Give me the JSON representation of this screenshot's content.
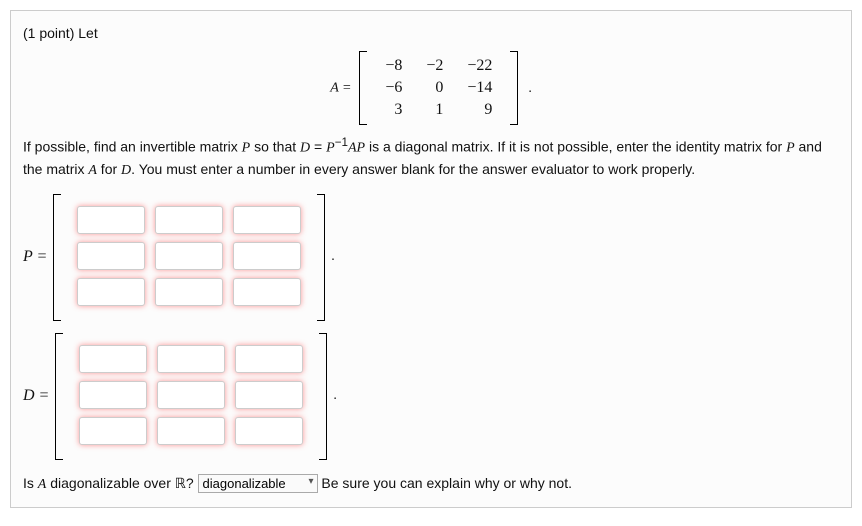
{
  "problem": {
    "points_label": "(1 point) Let",
    "A_matrix": {
      "prefix": "A =",
      "rows": [
        [
          "−8",
          "−2",
          "−22"
        ],
        [
          "−6",
          "0",
          "−14"
        ],
        [
          "3",
          "1",
          "9"
        ]
      ],
      "suffix": "."
    },
    "instruction": "If possible, find an invertible matrix P so that D = P⁻¹AP is a diagonal matrix. If it is not possible, enter the identity matrix for P and the matrix A for D. You must enter a number in every answer blank for the answer evaluator to work properly.",
    "P_label": "P =",
    "D_label": "D =",
    "question_prefix": "Is A diagonalizable over ℝ?",
    "select_value": "diagonalizable",
    "note": "Be sure you can explain why or why not."
  }
}
